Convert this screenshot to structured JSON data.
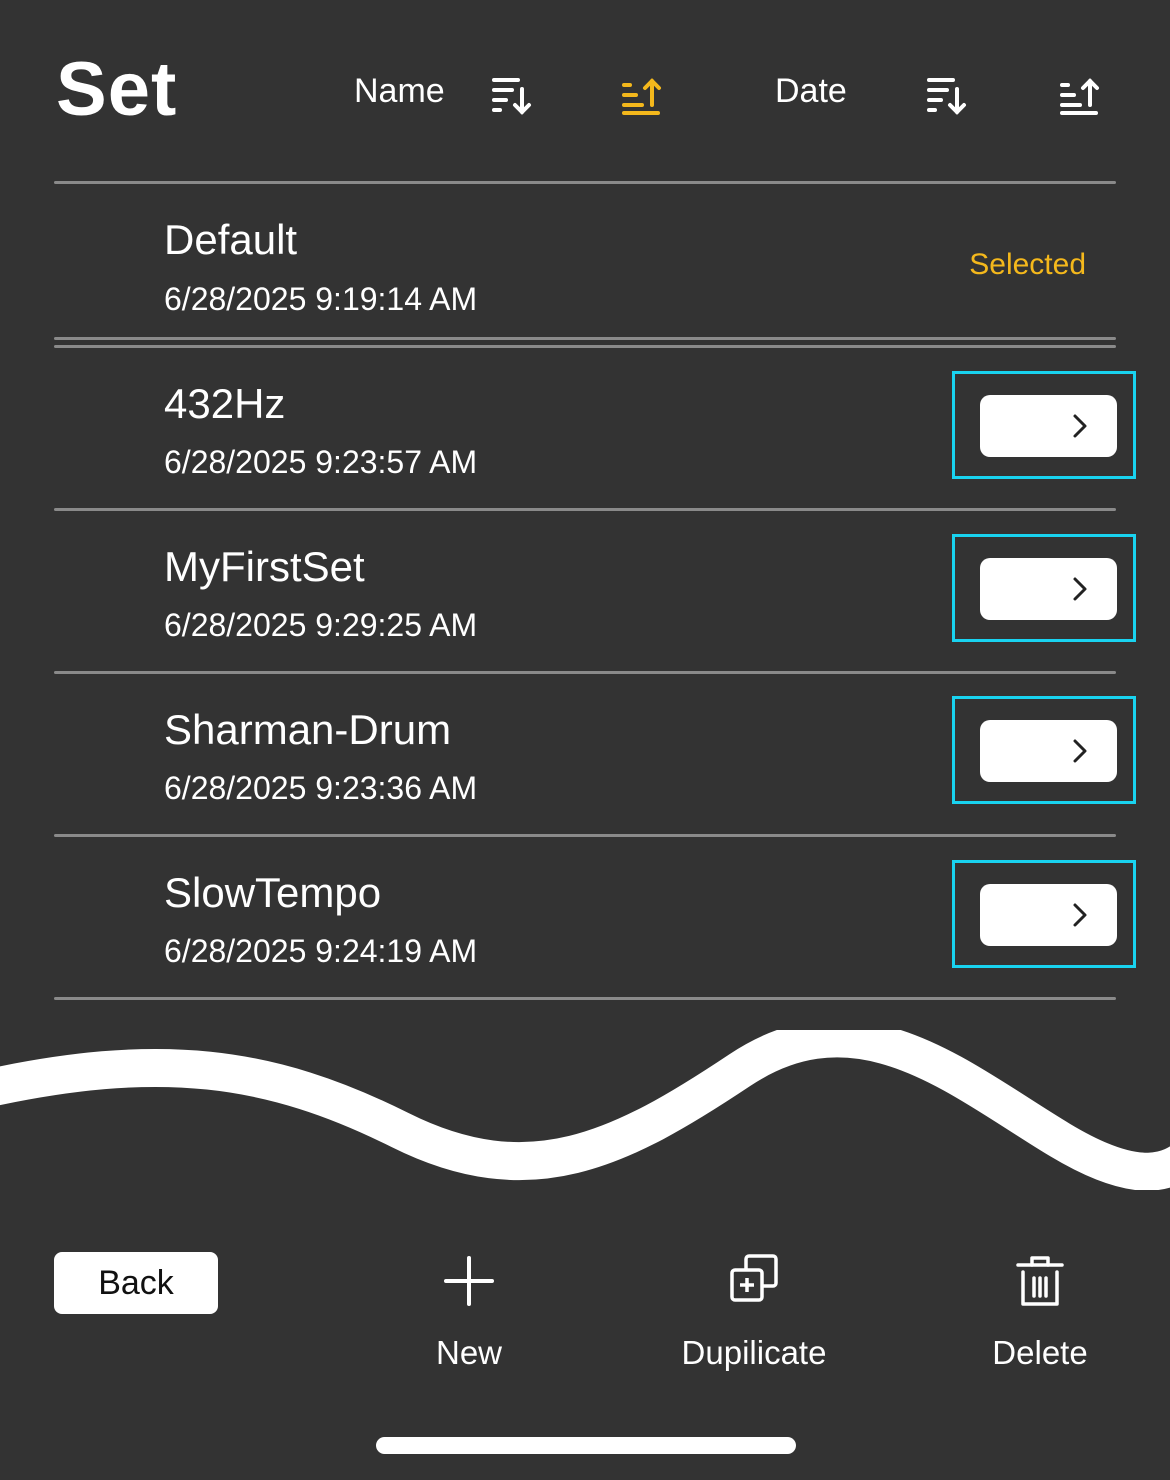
{
  "header": {
    "title": "Set",
    "sort_name_label": "Name",
    "sort_date_label": "Date",
    "active_accent": "#f4b81c",
    "icons": [
      "sort-descending-icon",
      "sort-ascending-icon",
      "sort-descending-icon",
      "sort-ascending-icon"
    ],
    "active_sort": "name-ascending"
  },
  "sets": [
    {
      "name": "Default",
      "date": "6/28/2025 9:19:14 AM",
      "status": "Selected"
    },
    {
      "name": "432Hz",
      "date": "6/28/2025 9:23:57 AM"
    },
    {
      "name": "MyFirstSet",
      "date": "6/28/2025 9:29:25 AM"
    },
    {
      "name": "Sharman-Drum",
      "date": "6/28/2025 9:23:36 AM"
    },
    {
      "name": "SlowTempo",
      "date": "6/28/2025 9:24:19 AM"
    }
  ],
  "footer": {
    "back_label": "Back",
    "new_label": "New",
    "duplicate_label": "Dupilicate",
    "delete_label": "Delete",
    "icons": [
      "plus-icon",
      "duplicate-icon",
      "trash-icon"
    ]
  },
  "colors": {
    "background": "#333333",
    "highlight_border": "#19d3f0",
    "selected_text": "#f4b81c"
  }
}
